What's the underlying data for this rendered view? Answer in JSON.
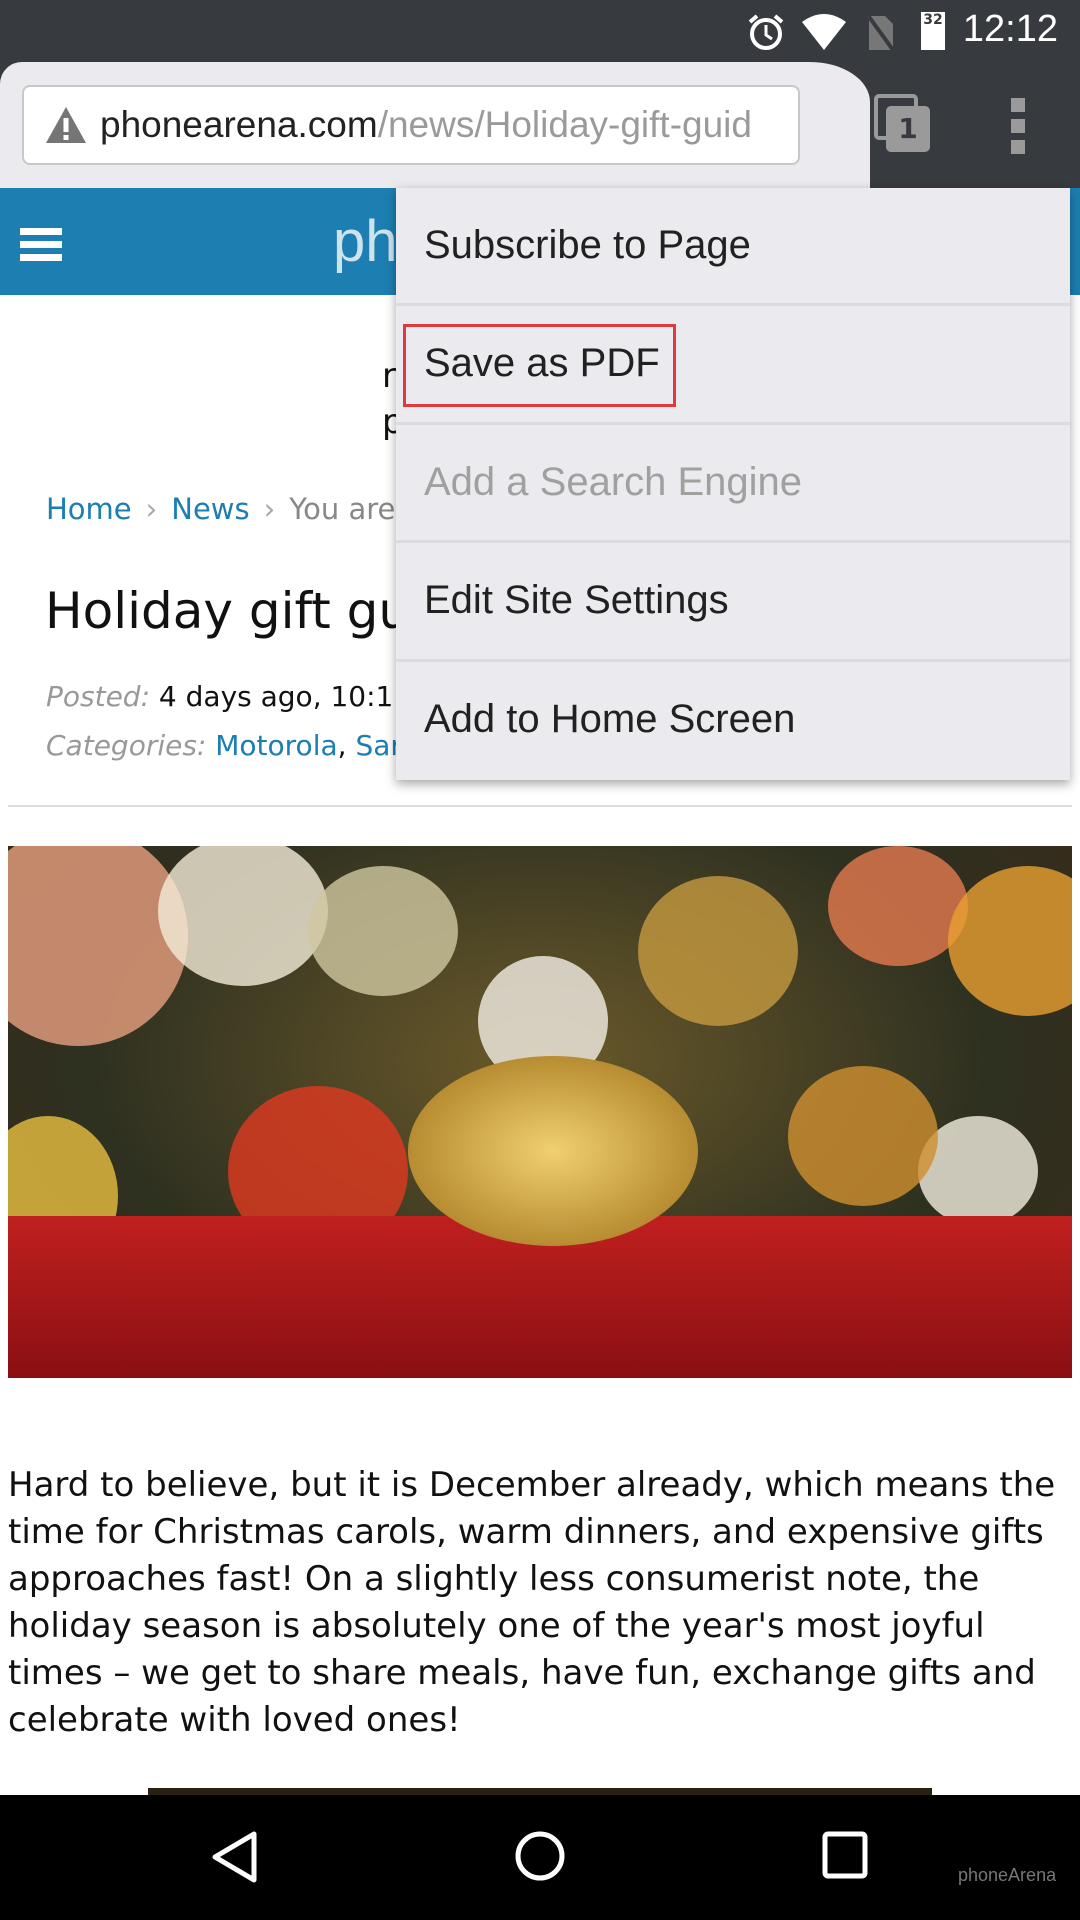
{
  "status_bar": {
    "time": "12:12",
    "battery": "32",
    "icons": [
      "alarm-icon",
      "wifi-icon",
      "no-sim-icon",
      "battery-icon"
    ]
  },
  "browser": {
    "url_domain": "phonearena.com",
    "url_path": "/news/Holiday-gift-guid",
    "tab_count": "1",
    "security": "warning-icon"
  },
  "site": {
    "logo_partial": "ph"
  },
  "page": {
    "partial_lines": [
      "r",
      "p"
    ],
    "breadcrumb": {
      "home": "Home",
      "news": "News",
      "current": "You are"
    },
    "title": "Holiday gift gu",
    "posted_label": "Posted:",
    "posted_value": "4 days ago, 10:1",
    "categories_label": "Categories:",
    "category1": "Motorola",
    "category2": "Sar",
    "paragraph": "Hard to believe, but it is December already, which means the time for Christmas carols, warm dinners, and expensive gifts approaches fast! On a slightly less consumerist note, the holiday season is absolutely one of the year's most joyful times – we get to share meals, have fun, exchange gifts and celebrate with loved ones!"
  },
  "menu": {
    "items": [
      {
        "label": "Subscribe to Page",
        "enabled": true
      },
      {
        "label": "Save as PDF",
        "enabled": true,
        "highlighted": true
      },
      {
        "label": "Add a Search Engine",
        "enabled": false
      },
      {
        "label": "Edit Site Settings",
        "enabled": true
      },
      {
        "label": "Add to Home Screen",
        "enabled": true
      }
    ]
  },
  "watermark": "phoneArena",
  "colors": {
    "brand": "#1c7eb1",
    "highlight": "#e0393e"
  }
}
